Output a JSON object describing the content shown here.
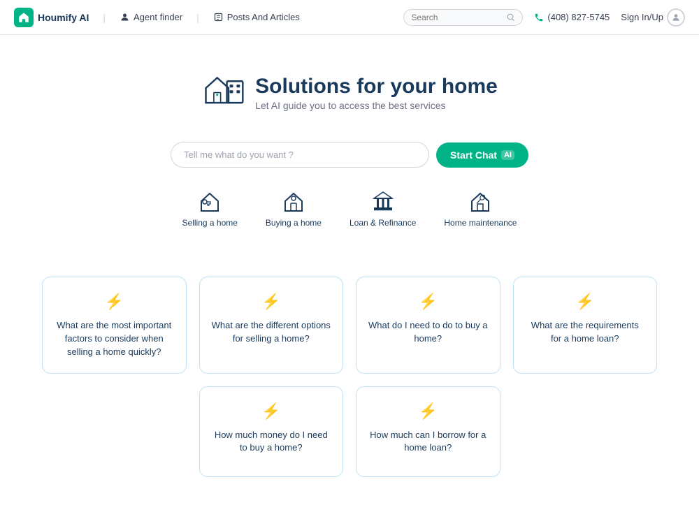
{
  "navbar": {
    "brand_name": "Houmify AI",
    "nav_items": [
      {
        "label": "Agent finder",
        "icon": "agent-icon"
      },
      {
        "label": "Posts And Articles",
        "icon": "article-icon"
      }
    ],
    "search_placeholder": "Search",
    "phone": "(408) 827-5745",
    "sign_in": "Sign In/Up"
  },
  "hero": {
    "title": "Solutions for your home",
    "subtitle": "Let AI guide you to access the best services"
  },
  "chat_bar": {
    "placeholder": "Tell me what do you want ?",
    "button_label": "Start Chat",
    "ai_badge": "AI"
  },
  "categories": [
    {
      "label": "Selling a home",
      "icon": "key-home-icon"
    },
    {
      "label": "Buying a home",
      "icon": "buy-home-icon"
    },
    {
      "label": "Loan & Refinance",
      "icon": "bank-icon"
    },
    {
      "label": "Home maintenance",
      "icon": "tools-home-icon"
    }
  ],
  "cards_row1": [
    {
      "text": "What are the most important factors to consider when selling a home quickly?"
    },
    {
      "text": "What are the different options for selling a home?"
    },
    {
      "text": "What do I need to do to buy a home?"
    },
    {
      "text": "What are the requirements for a home loan?"
    }
  ],
  "cards_row2": [
    {
      "text": "How much money do I need to buy a home?"
    },
    {
      "text": "How much can I borrow for a home loan?"
    }
  ],
  "colors": {
    "brand_green": "#00b386",
    "dark_blue": "#1a3a5c",
    "light_blue_border": "#bee3f8"
  }
}
